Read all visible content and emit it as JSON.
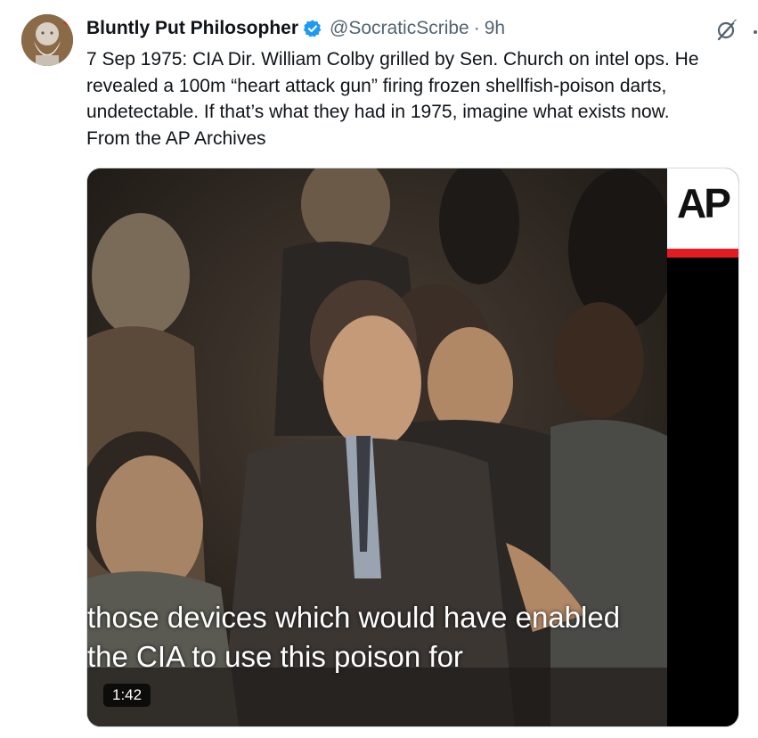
{
  "author": {
    "name": "Bluntly Put Philosopher",
    "handle": "@SocraticScribe",
    "separator": "·",
    "time": "9h",
    "verified": true,
    "avatar_icon": "socrates-bust-avatar"
  },
  "tweet": {
    "lines": [
      "7 Sep 1975: CIA Dir. William Colby grilled by Sen. Church on intel ops. He",
      "revealed a 100m “heart attack gun” firing frozen shellfish-poison darts,",
      "undetectable. If that’s what they had in 1975, imagine what exists now.",
      "From the AP Archives"
    ]
  },
  "media": {
    "logo_text": "AP",
    "caption_lines": [
      "those devices which would have enabled",
      "the CIA to use this poison for"
    ],
    "duration": "1:42"
  },
  "icons": {
    "verified": "verified-badge-icon",
    "grok": "grok-icon",
    "more": "more-icon"
  },
  "colors": {
    "verified_blue": "#1d9bf0",
    "secondary_text": "#536471",
    "ap_red": "#e31b23"
  }
}
